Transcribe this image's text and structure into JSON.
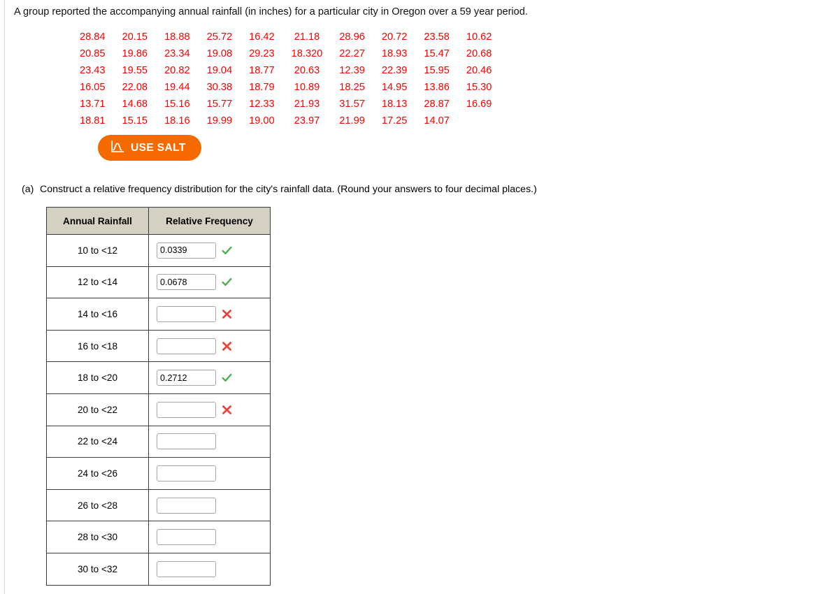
{
  "problem": {
    "intro": "A group reported the accompanying annual rainfall (in inches) for a particular city in Oregon over a 59 year period."
  },
  "rainfall_data": {
    "rows": [
      [
        "28.84",
        "20.15",
        "18.88",
        "25.72",
        "16.42",
        "21.18",
        "28.96",
        "20.72",
        "23.58",
        "10.62"
      ],
      [
        "20.85",
        "19.86",
        "23.34",
        "19.08",
        "29.23",
        "18.320",
        "22.27",
        "18.93",
        "15.47",
        "20.68"
      ],
      [
        "23.43",
        "19.55",
        "20.82",
        "19.04",
        "18.77",
        "20.63",
        "12.39",
        "22.39",
        "15.95",
        "20.46"
      ],
      [
        "16.05",
        "22.08",
        "19.44",
        "30.38",
        "18.79",
        "10.89",
        "18.25",
        "14.95",
        "13.86",
        "15.30"
      ],
      [
        "13.71",
        "14.68",
        "15.16",
        "15.77",
        "12.33",
        "21.93",
        "31.57",
        "18.13",
        "28.87",
        "16.69"
      ],
      [
        "18.81",
        "15.15",
        "18.16",
        "19.99",
        "19.00",
        "23.97",
        "21.99",
        "17.25",
        "14.07",
        ""
      ]
    ]
  },
  "salt_button": {
    "label": "USE SALT",
    "icon": "distribution-curve-icon",
    "color": "#f56a00"
  },
  "part_a": {
    "letter": "(a)",
    "text": "Construct a relative frequency distribution for the city's rainfall data. (Round your answers to four decimal places.)"
  },
  "frequency_table": {
    "headers": [
      "Annual Rainfall",
      "Relative Frequency"
    ],
    "header_bg": "#d5d1c2",
    "correct_color": "#4caf50",
    "incorrect_color": "#e8463c",
    "rows": [
      {
        "bin": "10 to <12",
        "value": "0.0339",
        "mark": "correct"
      },
      {
        "bin": "12 to <14",
        "value": "0.0678",
        "mark": "correct"
      },
      {
        "bin": "14 to <16",
        "value": "",
        "mark": "incorrect"
      },
      {
        "bin": "16 to <18",
        "value": "",
        "mark": "incorrect"
      },
      {
        "bin": "18 to <20",
        "value": "0.2712",
        "mark": "correct"
      },
      {
        "bin": "20 to <22",
        "value": "",
        "mark": "incorrect"
      },
      {
        "bin": "22 to <24",
        "value": "",
        "mark": "none"
      },
      {
        "bin": "24 to <26",
        "value": "",
        "mark": "none"
      },
      {
        "bin": "26 to <28",
        "value": "",
        "mark": "none"
      },
      {
        "bin": "28 to <30",
        "value": "",
        "mark": "none"
      },
      {
        "bin": "30 to <32",
        "value": "",
        "mark": "none"
      }
    ]
  }
}
